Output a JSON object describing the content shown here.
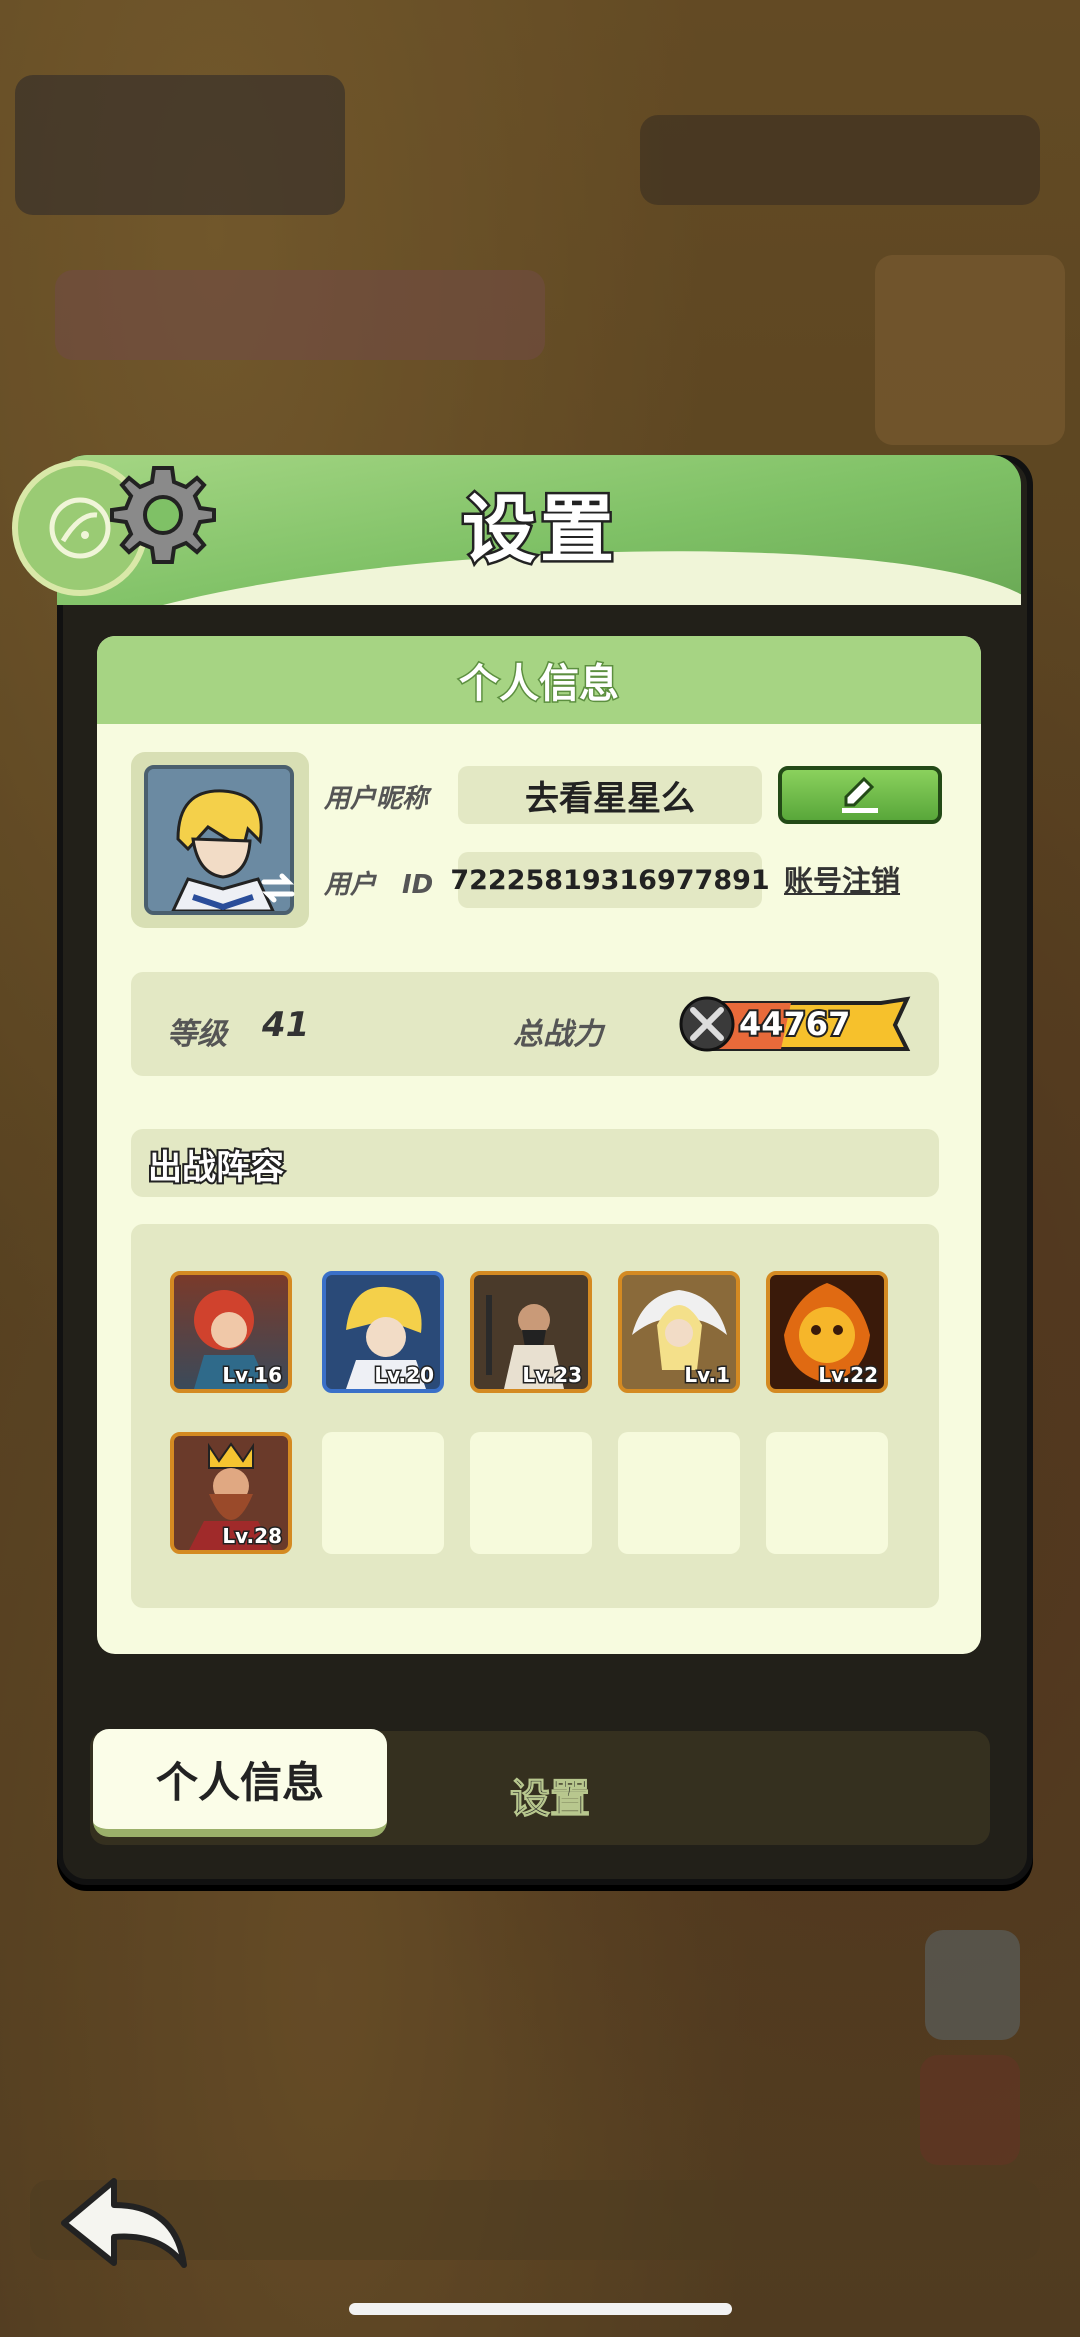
{
  "window": {
    "title": "设置"
  },
  "profile_section": {
    "header": "个人信息"
  },
  "profile": {
    "nickname_label": "用户昵称",
    "nickname": "去看星星么",
    "id_label": "用户　ID",
    "user_id": "72225819316977891",
    "logout_label": "账号注销"
  },
  "stats": {
    "level_label": "等级",
    "level": "41",
    "power_label": "总战力",
    "power": "44767"
  },
  "lineup": {
    "title": "出战阵容",
    "heroes": [
      {
        "level": "Lv.16"
      },
      {
        "level": "Lv.20"
      },
      {
        "level": "Lv.23"
      },
      {
        "level": "Lv.1"
      },
      {
        "level": "Lv.22"
      },
      {
        "level": "Lv.28"
      }
    ]
  },
  "tabs": [
    {
      "label": "个人信息",
      "active": true
    },
    {
      "label": "设置",
      "active": false
    }
  ],
  "colors": {
    "accent_green": "#7fc166",
    "panel_bg": "#f7fbdf",
    "power_bar": "#f6c12c"
  },
  "icons": [
    "planet-icon",
    "gear-icon",
    "edit-pencil-icon",
    "swap-arrow-icon",
    "crossed-swords-icon",
    "back-arrow-icon"
  ]
}
